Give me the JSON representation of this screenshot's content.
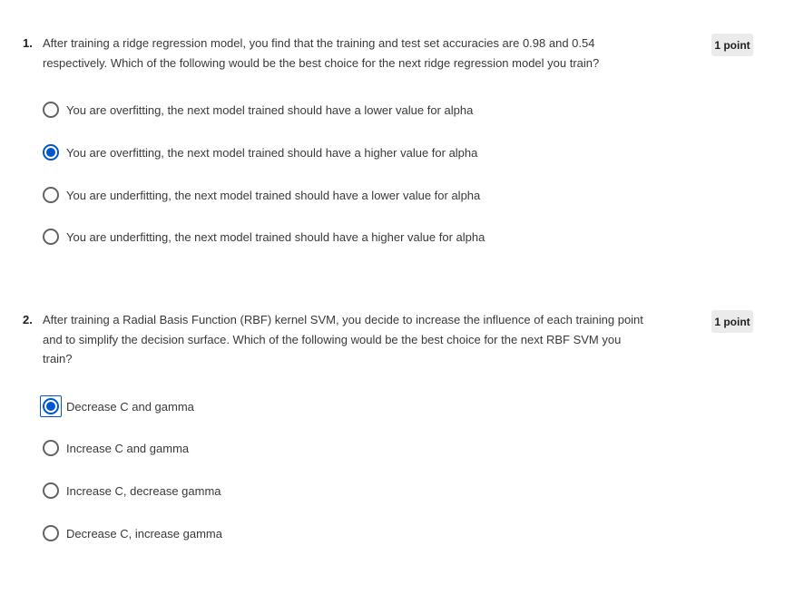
{
  "questions": [
    {
      "number": "1.",
      "text_lines": [
        "After training a ridge regression model, you find that the training and test set accuracies are 0.98 and 0.54",
        "respectively. Which of the following would be the best choice for the next ridge regression model you train?"
      ],
      "points": "1 point",
      "options": [
        {
          "label": "You are overfitting, the next model trained should have a lower value for alpha",
          "selected": false
        },
        {
          "label": "You are overfitting, the next model trained should have a higher value for alpha",
          "selected": true
        },
        {
          "label": "You are underfitting, the next model trained should have a lower value for alpha",
          "selected": false
        },
        {
          "label": "You are underfitting, the next model trained should have a higher value for alpha",
          "selected": false
        }
      ]
    },
    {
      "number": "2.",
      "text_lines": [
        "After training a Radial Basis Function (RBF) kernel SVM, you decide to increase the influence of each training point",
        "and to simplify the decision surface. Which of the following would be the best choice for the next RBF SVM you",
        "train?"
      ],
      "points": "1 point",
      "options": [
        {
          "label": "Decrease C and gamma",
          "selected": true
        },
        {
          "label": "Increase C and gamma",
          "selected": false
        },
        {
          "label": "Increase C, decrease gamma",
          "selected": false
        },
        {
          "label": "Decrease C, increase gamma",
          "selected": false
        }
      ]
    }
  ],
  "colors": {
    "accent": "#0056d2",
    "radio_border": "#636363",
    "points_badge_bg": "#ebebeb",
    "text": "#373a3c"
  }
}
